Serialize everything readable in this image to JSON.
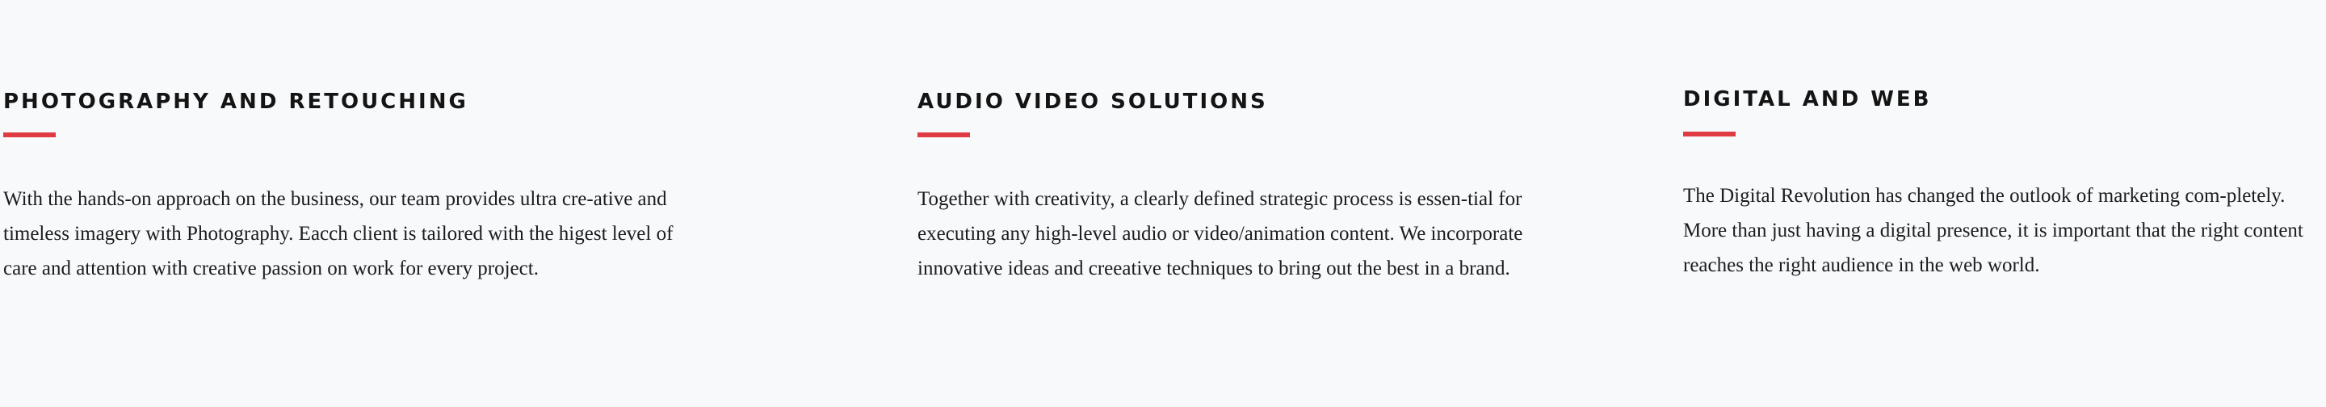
{
  "colors": {
    "background": "#f8f9fb",
    "accent": "#e03b43",
    "heading": "#141414",
    "text": "#1c1c1c"
  },
  "services": [
    {
      "title": "PHOTOGRAPHY AND RETOUCHING",
      "body": "With the hands-on approach on the business, our team provides ultra cre-ative and timeless imagery with Photography. Eacch client is tailored with the higest level of care and attention with creative passion on work for every project."
    },
    {
      "title": "AUDIO VIDEO SOLUTIONS",
      "body": "Together with creativity, a clearly defined strategic process is essen-tial for executing any high-level audio or video/animation content. We incorporate innovative ideas and creeative techniques to bring out the best in a brand."
    },
    {
      "title": "DIGITAL AND WEB",
      "body": "The Digital Revolution has changed the outlook of marketing com-pletely. More than just having a digital presence, it is important that the right content reaches the right audience in the web world."
    }
  ]
}
